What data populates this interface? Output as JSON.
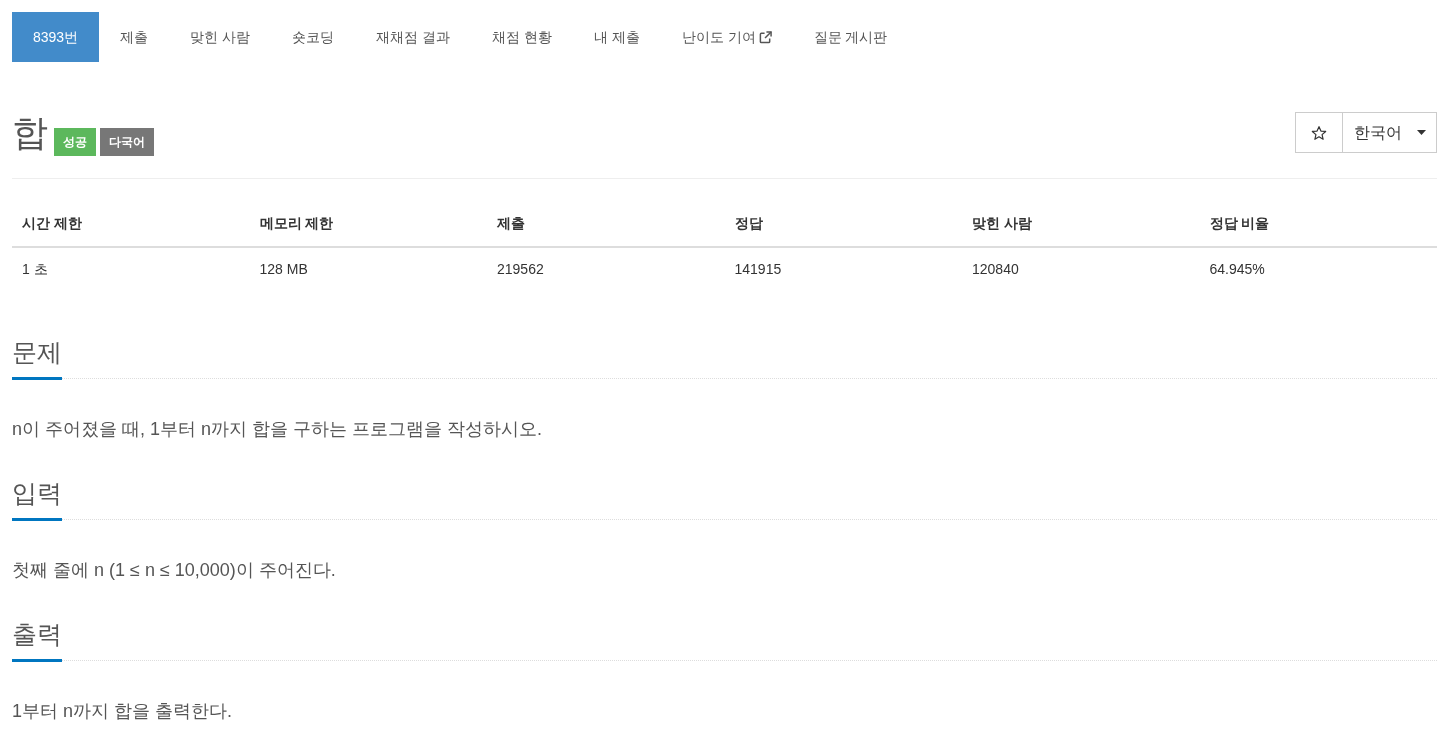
{
  "nav_tabs": [
    {
      "label": "8393번",
      "selected": true,
      "external": false
    },
    {
      "label": "제출",
      "selected": false,
      "external": false
    },
    {
      "label": "맞힌 사람",
      "selected": false,
      "external": false
    },
    {
      "label": "숏코딩",
      "selected": false,
      "external": false
    },
    {
      "label": "재채점 결과",
      "selected": false,
      "external": false
    },
    {
      "label": "채점 현황",
      "selected": false,
      "external": false
    },
    {
      "label": "내 제출",
      "selected": false,
      "external": false
    },
    {
      "label": "난이도 기여",
      "selected": false,
      "external": true
    },
    {
      "label": "질문 게시판",
      "selected": false,
      "external": false
    }
  ],
  "problem_header": {
    "title": "합",
    "badges": [
      {
        "label": "성공",
        "color": "#5cb85c"
      },
      {
        "label": "다국어",
        "color": "#777777"
      }
    ],
    "favorite": {
      "starred": false
    },
    "language_select": {
      "value": "한국어"
    }
  },
  "info_table": {
    "columns": [
      "시간 제한",
      "메모리 제한",
      "제출",
      "정답",
      "맞힌 사람",
      "정답 비율"
    ],
    "rows": [
      [
        "1 초",
        "128 MB",
        "219562",
        "141915",
        "120840",
        "64.945%"
      ]
    ]
  },
  "sections": [
    {
      "heading": "문제",
      "body": "n이 주어졌을 때, 1부터 n까지 합을 구하는 프로그램을 작성하시오."
    },
    {
      "heading": "입력",
      "body": "첫째 줄에 n (1 ≤ n ≤ 10,000)이 주어진다."
    },
    {
      "heading": "출력",
      "body": "1부터 n까지 합을 출력한다."
    }
  ]
}
